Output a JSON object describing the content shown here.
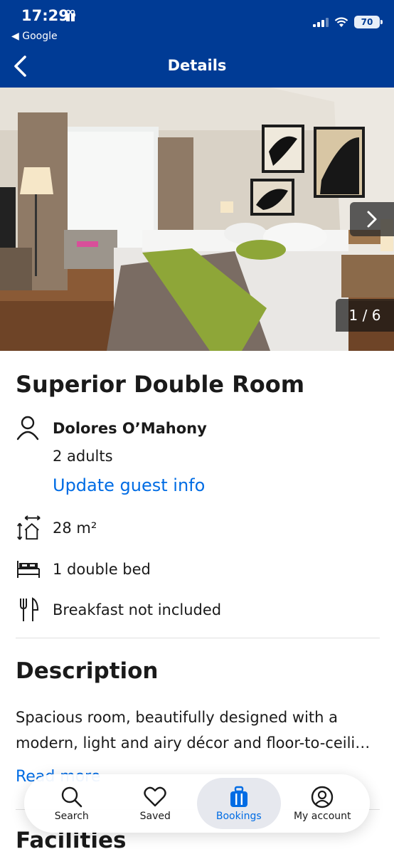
{
  "status": {
    "time": "17:29",
    "back_app": "◀ Google",
    "battery": "70"
  },
  "header": {
    "title": "Details"
  },
  "gallery": {
    "counter": "1 / 6"
  },
  "room": {
    "title": "Superior Double Room",
    "guest_name": "Dolores  O’Mahony",
    "guest_count": "2 adults",
    "update_link": "Update guest info",
    "size": "28 m²",
    "beds": "1 double bed",
    "breakfast": "Breakfast not included"
  },
  "description": {
    "heading": "Description",
    "line1": "Spacious room, beautifully designed with a",
    "line2": "modern, light and airy décor and floor-to-ceili…",
    "read_more": "Read more"
  },
  "facilities": {
    "heading": "Facilities"
  },
  "bottom_nav": {
    "items": [
      {
        "label": "Search",
        "icon": "search-icon"
      },
      {
        "label": "Saved",
        "icon": "heart-icon"
      },
      {
        "label": "Bookings",
        "icon": "suitcase-icon",
        "active": true
      },
      {
        "label": "My account",
        "icon": "person-icon"
      }
    ]
  },
  "colors": {
    "brand": "#003b95",
    "link": "#006ce4"
  }
}
